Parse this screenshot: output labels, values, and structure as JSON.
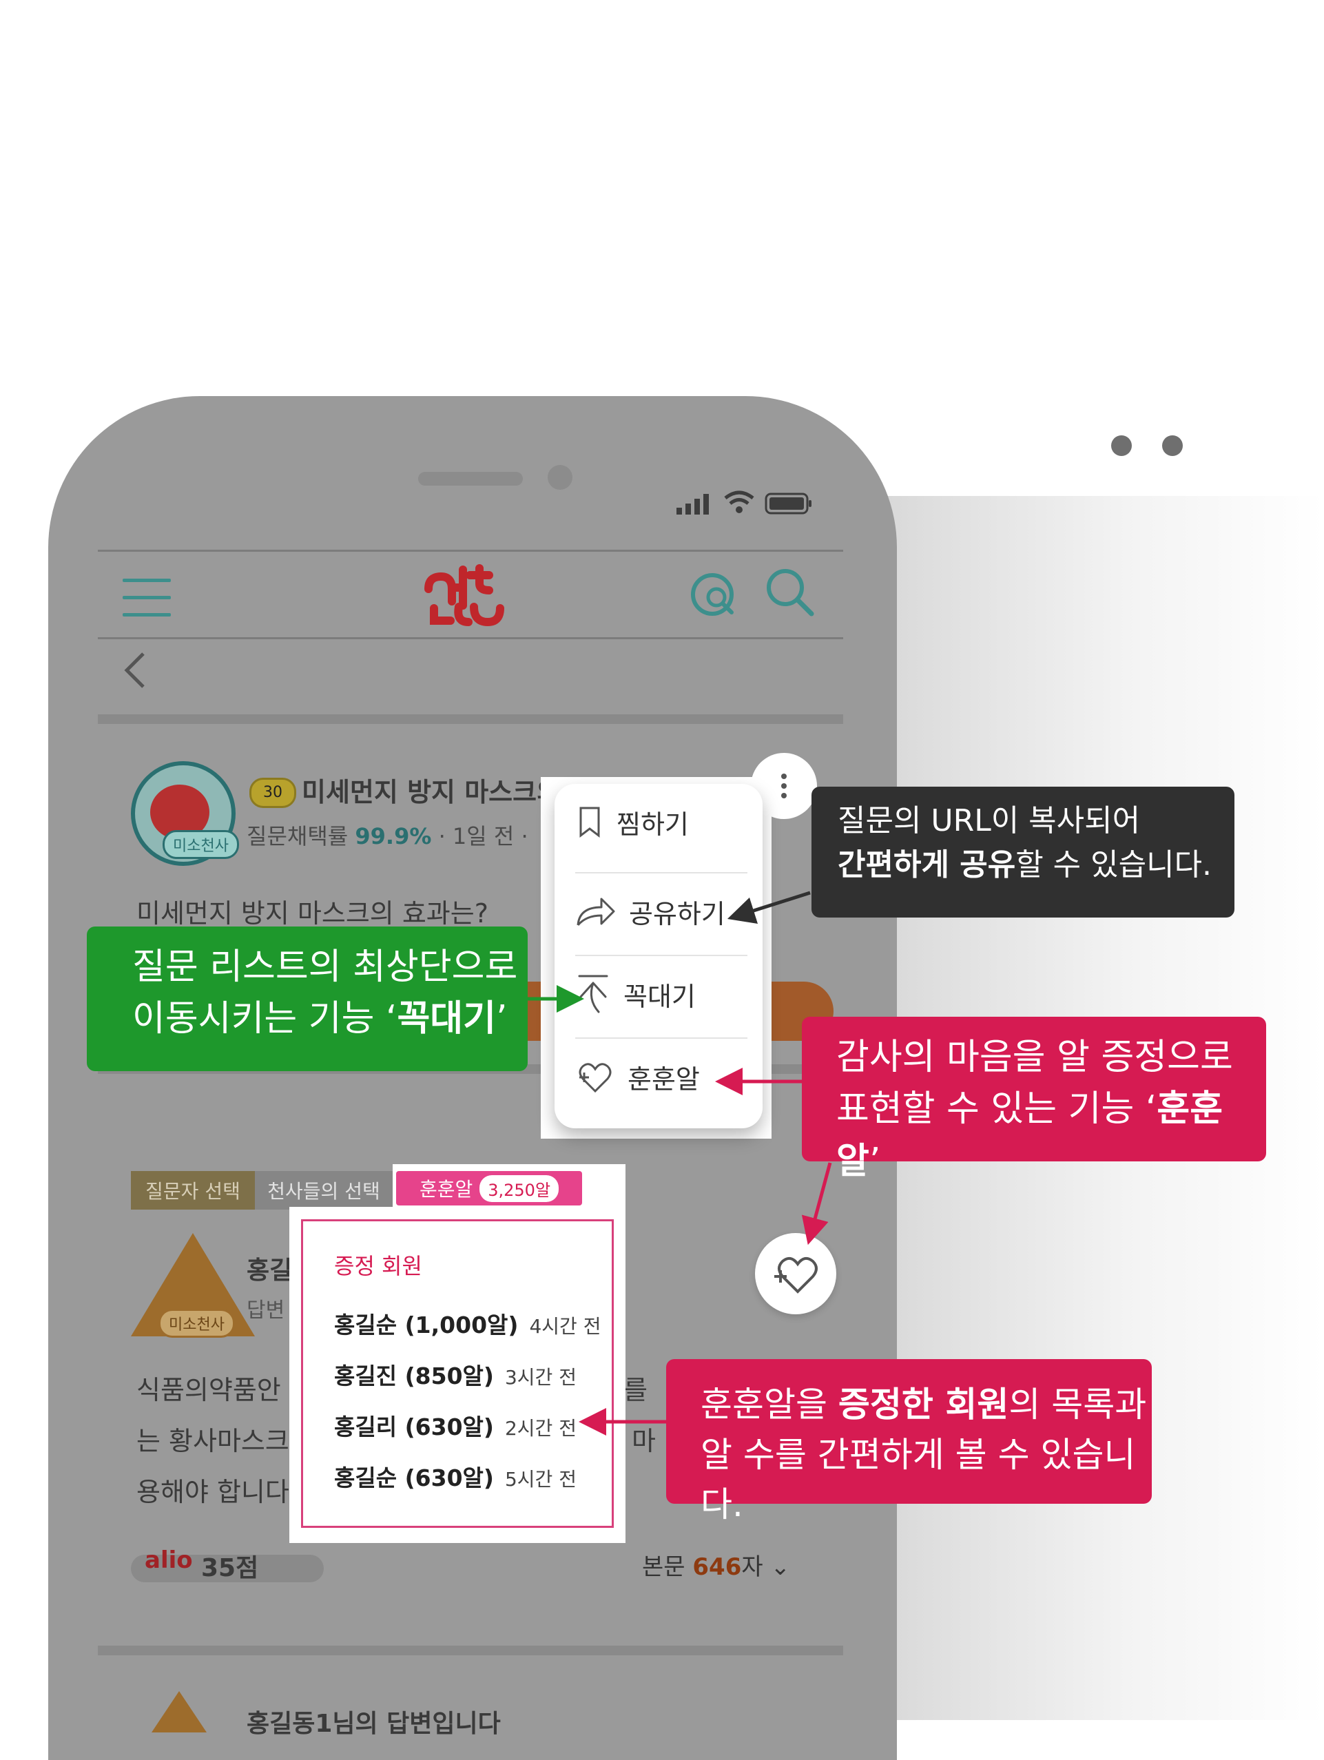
{
  "status_bar": {
    "icons": [
      "signal-icon",
      "wifi-icon",
      "battery-icon"
    ]
  },
  "header": {
    "logo": "알려",
    "icons": [
      "menu-icon",
      "profile-search-icon",
      "search-icon"
    ],
    "back": "back-chevron-icon"
  },
  "question": {
    "level": "30",
    "title": "미세먼지 방지 마스크의 효과는?",
    "rate_label": "질문채택률",
    "rate_value": "99.9%",
    "time": "· 1일 전 ·",
    "badge": "미소천사",
    "body": "미세먼지 방지 마스크의 효과는?"
  },
  "menu": {
    "items": [
      {
        "label": "찜하기",
        "icon": "bookmark-icon"
      },
      {
        "label": "공유하기",
        "icon": "share-icon"
      },
      {
        "label": "꼭대기",
        "icon": "to-top-icon"
      },
      {
        "label": "훈훈알",
        "icon": "heart-plus-icon"
      }
    ]
  },
  "answer": {
    "tags": [
      "질문자 선택",
      "천사들의 선택",
      "훈훈알"
    ],
    "heart_count": "3,250알",
    "author": "홍길",
    "author_sub": "답변",
    "badge": "미소천사",
    "body_lines": [
      "식품의약품안",
      "는 황사마스크",
      "용해야 합니다"
    ],
    "body_right": [
      "터를 ",
      "용 마"
    ],
    "score": "35점",
    "length_prefix": "본문",
    "length_value": "646",
    "length_suffix": "자",
    "next_title": "홍길동1님의 답변입니다"
  },
  "donors": {
    "title": "증정 회원",
    "rows": [
      {
        "name": "홍길순 (1,000알)",
        "time": "4시간 전"
      },
      {
        "name": "홍길진 (850알)",
        "time": "3시간 전"
      },
      {
        "name": "홍길리 (630알)",
        "time": "2시간 전"
      },
      {
        "name": "홍길순 (630알)",
        "time": "5시간 전"
      }
    ]
  },
  "callouts": {
    "share": {
      "line1": "질문의 URL이 복사되어",
      "line2_bold": "간편하게 공유",
      "line2_rest": "할 수 있습니다."
    },
    "top": {
      "line1": "질문 리스트의 최상단으로",
      "line2_pre": "이동시키는 기능 ‘",
      "line2_bold": "꼭대기",
      "line2_post": "’"
    },
    "heart": {
      "line1": "감사의 마음을 알 증정으로",
      "line2_pre": "표현할 수 있는 기능 ‘",
      "line2_bold": "훈훈알",
      "line2_post": "’"
    },
    "donor": {
      "line1_pre": "훈훈알을 ",
      "line1_bold": "증정한 회원",
      "line1_post": "의 목록과",
      "line2": "알 수를 간편하게 볼 수 있습니다."
    }
  },
  "colors": {
    "green": "#1e982c",
    "dark": "#303030",
    "red": "#d61b52",
    "brand_red": "#c0262b",
    "teal": "#3d8f8c"
  }
}
